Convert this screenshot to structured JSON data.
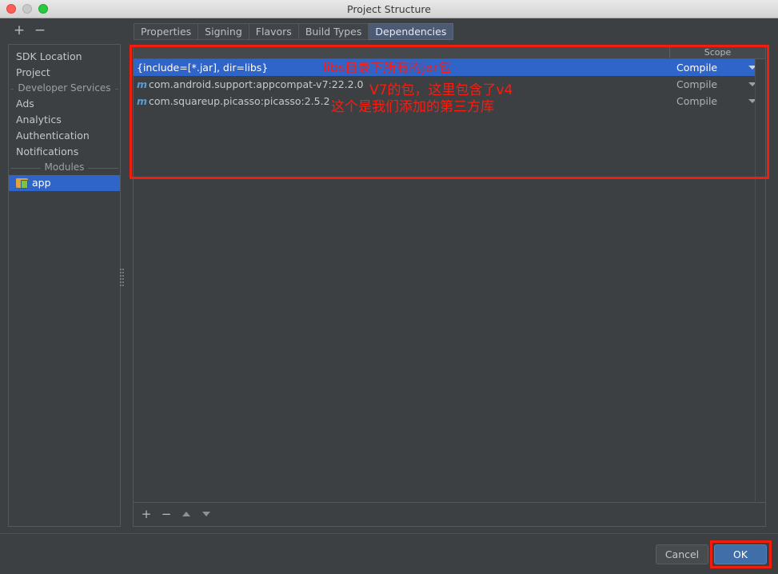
{
  "window": {
    "title": "Project Structure",
    "traffic_lights": [
      "close-light",
      "minimize-light",
      "maximize-light"
    ]
  },
  "toolbar": {
    "add_label": "+",
    "remove_label": "−"
  },
  "tabs": [
    {
      "label": "Properties",
      "active": false
    },
    {
      "label": "Signing",
      "active": false
    },
    {
      "label": "Flavors",
      "active": false
    },
    {
      "label": "Build Types",
      "active": false
    },
    {
      "label": "Dependencies",
      "active": true
    }
  ],
  "sidebar": {
    "items": [
      {
        "label": "SDK Location"
      },
      {
        "label": "Project"
      }
    ],
    "section_developer_services": "Developer Services",
    "services": [
      {
        "label": "Ads"
      },
      {
        "label": "Analytics"
      },
      {
        "label": "Authentication"
      },
      {
        "label": "Notifications"
      }
    ],
    "section_modules": "Modules",
    "modules": [
      {
        "label": "app",
        "selected": true,
        "icon": "android-module-icon"
      }
    ]
  },
  "dependencies_table": {
    "columns": {
      "name": "",
      "scope": "Scope"
    },
    "rows": [
      {
        "name": "{include=[*.jar], dir=libs}",
        "icon": "",
        "scope": "Compile",
        "selected": true
      },
      {
        "name": "com.android.support:appcompat-v7:22.2.0",
        "icon": "m",
        "scope": "Compile",
        "selected": false
      },
      {
        "name": "com.squareup.picasso:picasso:2.5.2",
        "icon": "m",
        "scope": "Compile",
        "selected": false
      }
    ]
  },
  "list_toolbar": {
    "add_label": "+",
    "remove_label": "−",
    "move_up_label": "move-up",
    "move_down_label": "move-down"
  },
  "footer": {
    "cancel_label": "Cancel",
    "ok_label": "OK"
  },
  "annotations": {
    "text_1": "libs目录下所有的jar包",
    "text_2": "V7的包，这里包含了v4",
    "text_3": "这个是我们添加的第三方库",
    "color": "#ff1a0d"
  },
  "colors": {
    "panel_bg": "#3c4043",
    "selection_blue": "#2f65c8",
    "tab_active": "#4d5a74",
    "ok_button": "#3f6ea8",
    "annotation_red": "#f21d0d"
  }
}
